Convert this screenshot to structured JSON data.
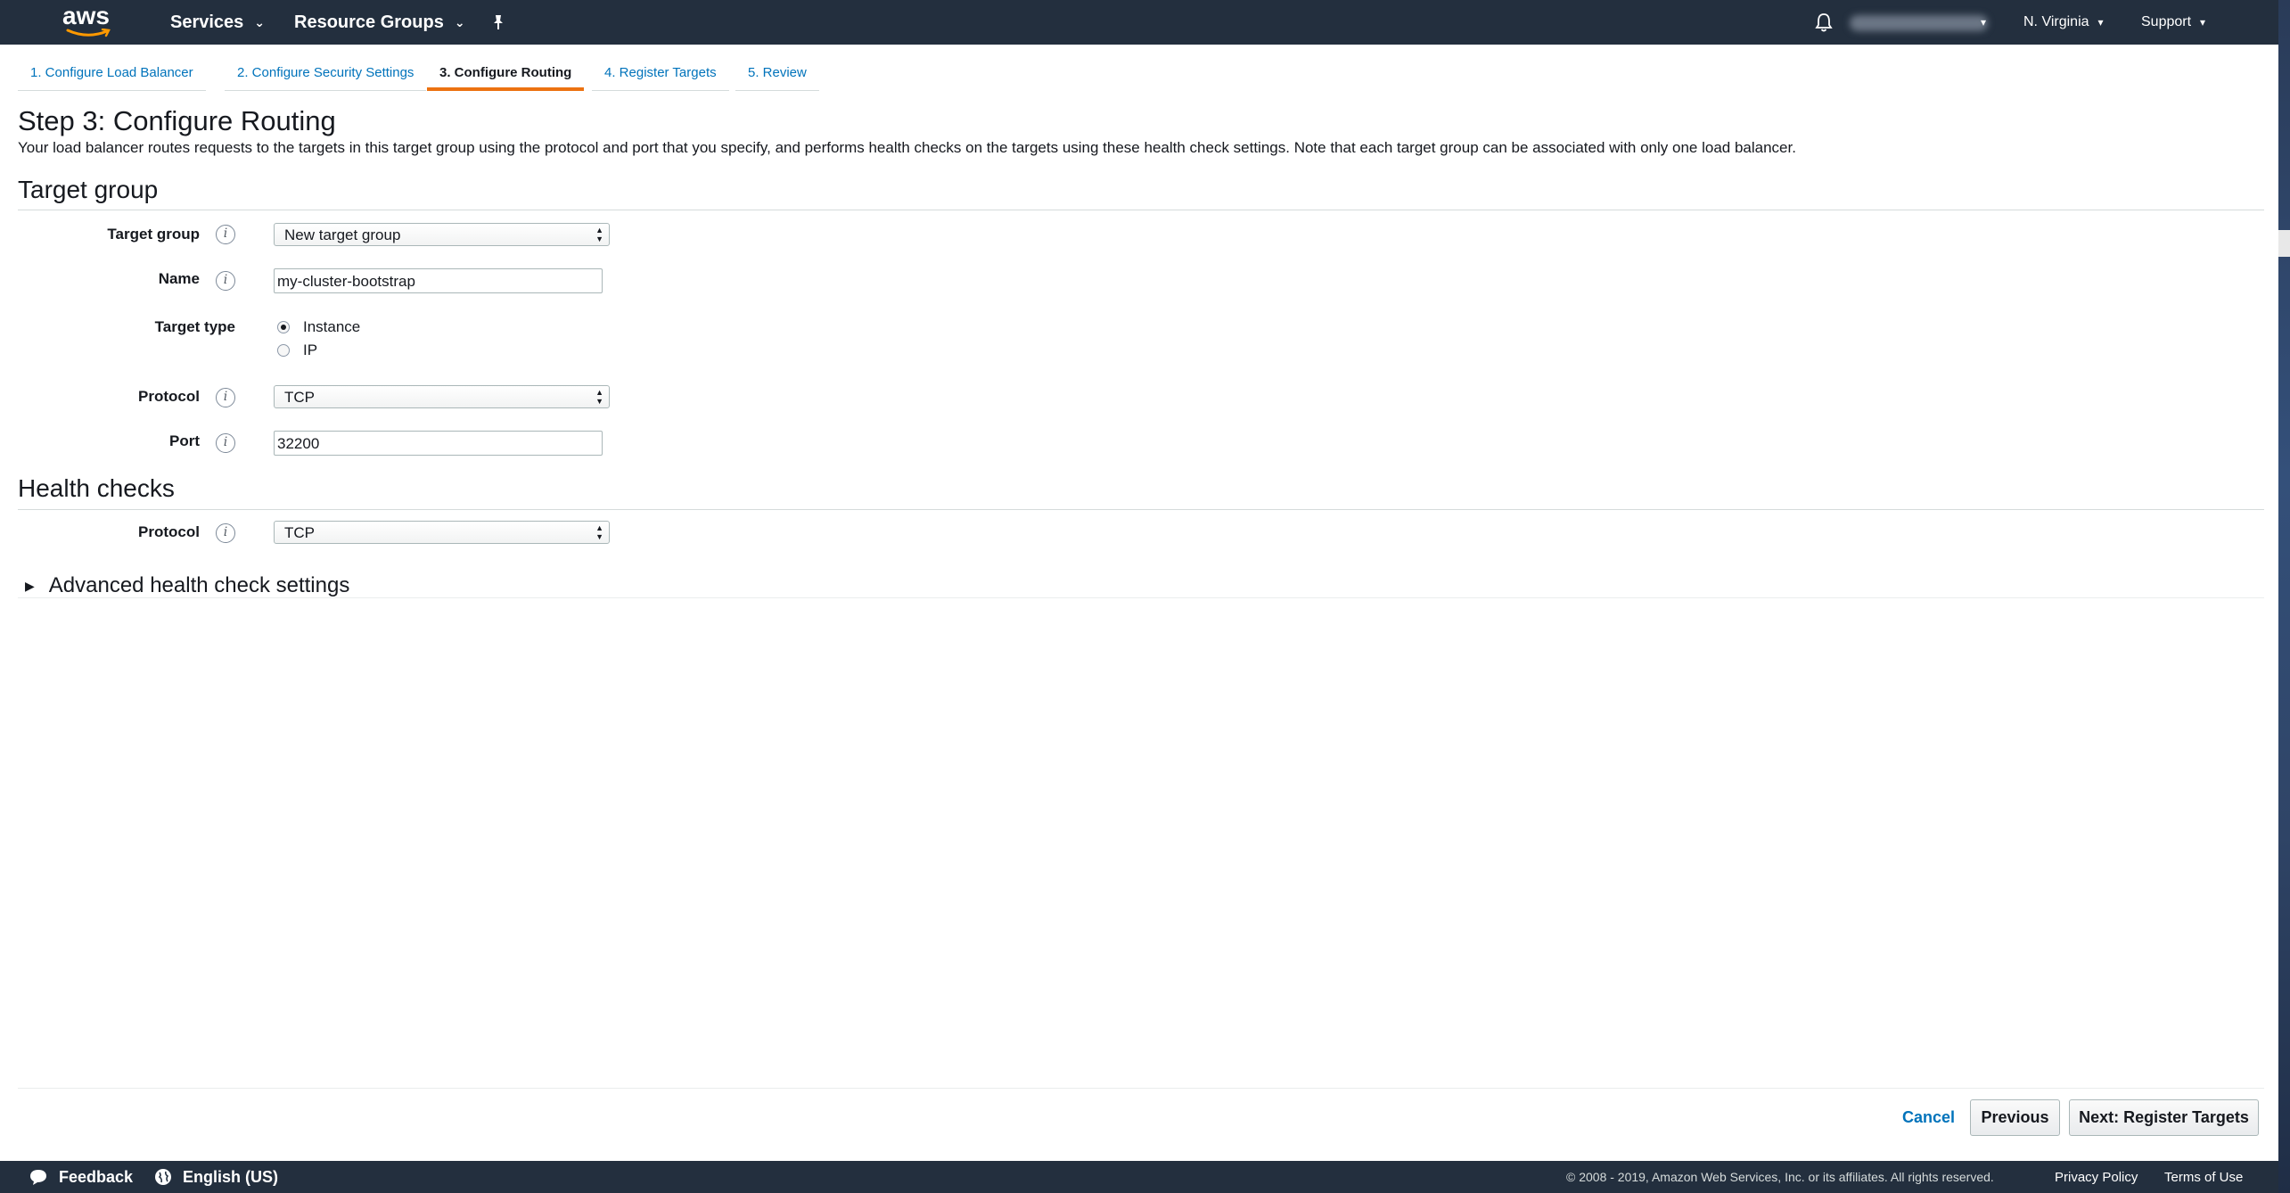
{
  "topnav": {
    "logo_text": "aws",
    "services": "Services",
    "resource_groups": "Resource Groups",
    "region": "N. Virginia",
    "support": "Support"
  },
  "tabs": [
    {
      "label": "1. Configure Load Balancer",
      "active": false
    },
    {
      "label": "2. Configure Security Settings",
      "active": false
    },
    {
      "label": "3. Configure Routing",
      "active": true
    },
    {
      "label": "4. Register Targets",
      "active": false
    },
    {
      "label": "5. Review",
      "active": false
    }
  ],
  "page": {
    "title": "Step 3: Configure Routing",
    "description": "Your load balancer routes requests to the targets in this target group using the protocol and port that you specify, and performs health checks on the targets using these health check settings. Note that each target group can be associated with only one load balancer."
  },
  "target_group_section": {
    "title": "Target group",
    "target_group_label": "Target group",
    "target_group_value": "New target group",
    "name_label": "Name",
    "name_value": "my-cluster-bootstrap",
    "target_type_label": "Target type",
    "target_type_options": [
      {
        "label": "Instance",
        "checked": true
      },
      {
        "label": "IP",
        "checked": false
      }
    ],
    "protocol_label": "Protocol",
    "protocol_value": "TCP",
    "port_label": "Port",
    "port_value": "32200"
  },
  "health_checks_section": {
    "title": "Health checks",
    "protocol_label": "Protocol",
    "protocol_value": "TCP",
    "advanced_label": "Advanced health check settings"
  },
  "actions": {
    "cancel": "Cancel",
    "previous": "Previous",
    "next": "Next: Register Targets"
  },
  "footer": {
    "feedback": "Feedback",
    "language": "English (US)",
    "copyright": "© 2008 - 2019, Amazon Web Services, Inc. or its affiliates. All rights reserved.",
    "privacy": "Privacy Policy",
    "terms": "Terms of Use"
  },
  "colors": {
    "nav_bg": "#232f3e",
    "link": "#0073bb",
    "active_tab_underline": "#ec7211"
  },
  "icons": [
    "aws-smile-icon",
    "chevron-down-icon",
    "pin-icon",
    "bell-icon",
    "info-icon",
    "caret-right-icon",
    "speech-bubble-icon",
    "globe-icon"
  ]
}
